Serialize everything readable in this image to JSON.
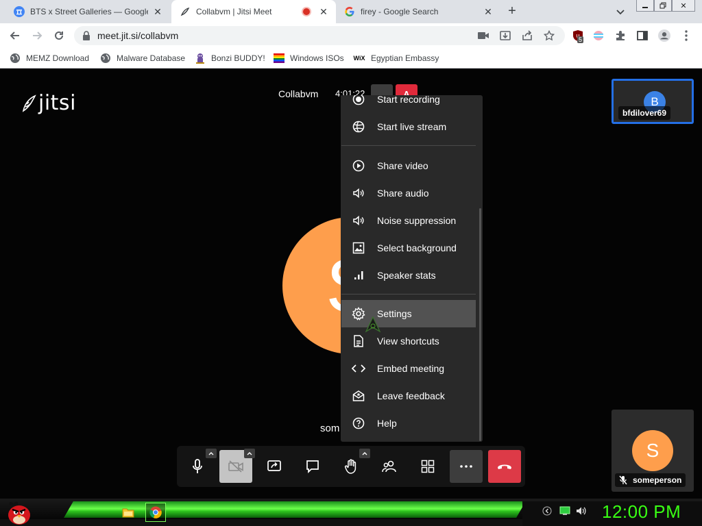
{
  "tabs": [
    {
      "title": "BTS x Street Galleries — Google A",
      "favicon": "google-arts-icon",
      "active": false
    },
    {
      "title": "Collabvm | Jitsi Meet",
      "favicon": "jitsi-icon",
      "active": true,
      "recording": true
    },
    {
      "title": "firey - Google Search",
      "favicon": "google-icon",
      "active": false
    }
  ],
  "address_bar": {
    "url": "meet.jit.si/collabvm"
  },
  "bookmarks": [
    {
      "label": "MEMZ Download",
      "icon": "globe-icon"
    },
    {
      "label": "Malware Database",
      "icon": "globe-icon"
    },
    {
      "label": "Bonzi BUDDY!",
      "icon": "bonzi-icon"
    },
    {
      "label": "Windows ISOs",
      "icon": "windows-flag-icon"
    },
    {
      "label": "Egyptian Embassy",
      "icon": "wix-icon"
    }
  ],
  "extensions": {
    "badge_count": "5"
  },
  "meeting": {
    "logo": "jitsi",
    "conference_name": "Collabvm",
    "timer": "4:01:22",
    "alert_label": "A",
    "main_participant_initial": "S",
    "main_participant_name": "som",
    "local_thumbnail": {
      "initial": "B",
      "name": "bfdilover69"
    },
    "remote_thumbnail": {
      "initial": "S",
      "name": "someperson"
    }
  },
  "more_menu": {
    "items": [
      {
        "label": "Start recording",
        "icon": "record-icon"
      },
      {
        "label": "Start live stream",
        "icon": "live-stream-icon"
      },
      {
        "label": "Share video",
        "icon": "play-icon"
      },
      {
        "label": "Share audio",
        "icon": "speaker-icon"
      },
      {
        "label": "Noise suppression",
        "icon": "noise-suppression-icon"
      },
      {
        "label": "Select background",
        "icon": "image-icon"
      },
      {
        "label": "Speaker stats",
        "icon": "bar-chart-icon"
      },
      {
        "label": "Settings",
        "icon": "gear-icon",
        "hovered": true
      },
      {
        "label": "View shortcuts",
        "icon": "document-icon"
      },
      {
        "label": "Embed meeting",
        "icon": "code-icon"
      },
      {
        "label": "Leave feedback",
        "icon": "feedback-icon"
      },
      {
        "label": "Help",
        "icon": "help-icon"
      }
    ]
  },
  "toolbox": {
    "buttons": [
      "microphone",
      "camera-off",
      "screen-share",
      "chat",
      "raise-hand",
      "participants",
      "tile-view",
      "more",
      "hangup"
    ]
  },
  "taskbar": {
    "clock": "12:00 PM",
    "apps": [
      "file-explorer",
      "chrome"
    ]
  },
  "colors": {
    "accent_blue": "#246fe5",
    "avatar_orange": "#fe9e4c",
    "hangup_red": "#dd3a47",
    "clock_green": "#39ff14"
  }
}
